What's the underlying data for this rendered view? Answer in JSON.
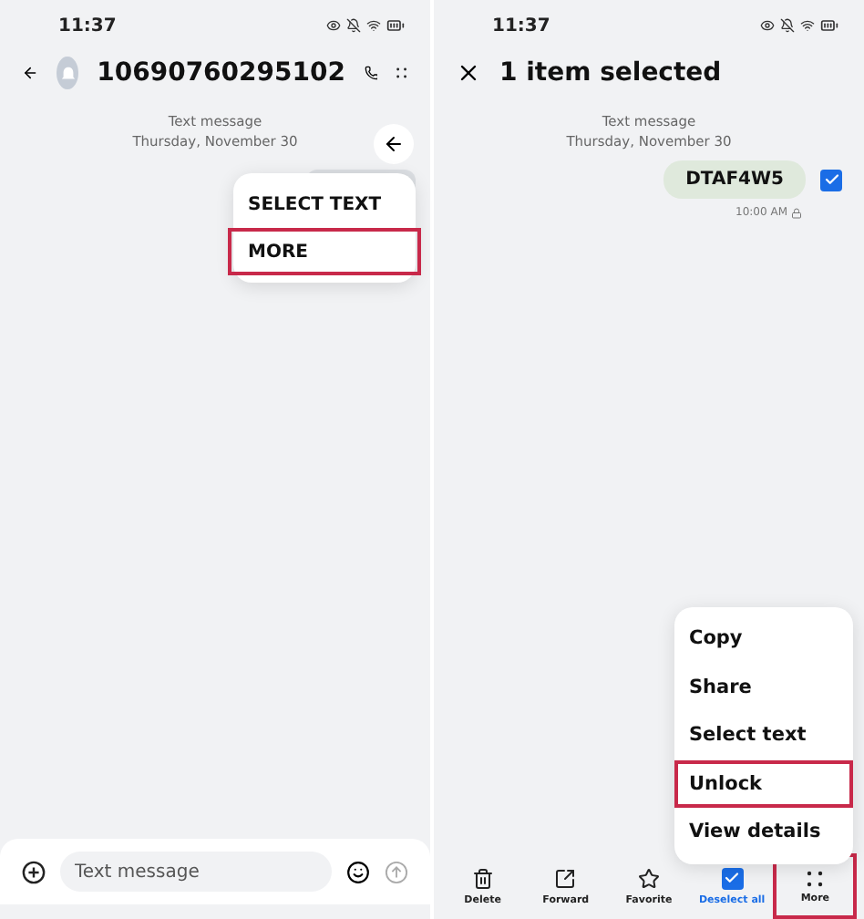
{
  "conversation": {
    "status_time": "11:37",
    "title": "10690760295102",
    "thread_label": "Text message",
    "date": "Thursday, November 30",
    "menu": [
      {
        "label": "SELECT TEXT",
        "highlighted": false
      },
      {
        "label": "MORE",
        "highlighted": true
      }
    ],
    "composer": {
      "placeholder": "Text message"
    }
  },
  "selection": {
    "status_time": "11:37",
    "title": "1 item selected",
    "thread_label": "Text message",
    "date": "Thursday, November 30",
    "message": {
      "text": "DTAF4W5",
      "time": "10:00 AM",
      "selected": true
    },
    "menu": [
      {
        "label": "Copy",
        "highlighted": false
      },
      {
        "label": "Share",
        "highlighted": false
      },
      {
        "label": "Select text",
        "highlighted": false
      },
      {
        "label": "Unlock",
        "highlighted": true
      },
      {
        "label": "View details",
        "highlighted": false
      }
    ],
    "toolbar": [
      {
        "kind": "delete",
        "label": "Delete",
        "active": false,
        "highlighted": false
      },
      {
        "kind": "forward",
        "label": "Forward",
        "active": false,
        "highlighted": false
      },
      {
        "kind": "favorite",
        "label": "Favorite",
        "active": false,
        "highlighted": false
      },
      {
        "kind": "deselect",
        "label": "Deselect all",
        "active": true,
        "highlighted": false
      },
      {
        "kind": "more",
        "label": "More",
        "active": false,
        "highlighted": true
      }
    ]
  }
}
